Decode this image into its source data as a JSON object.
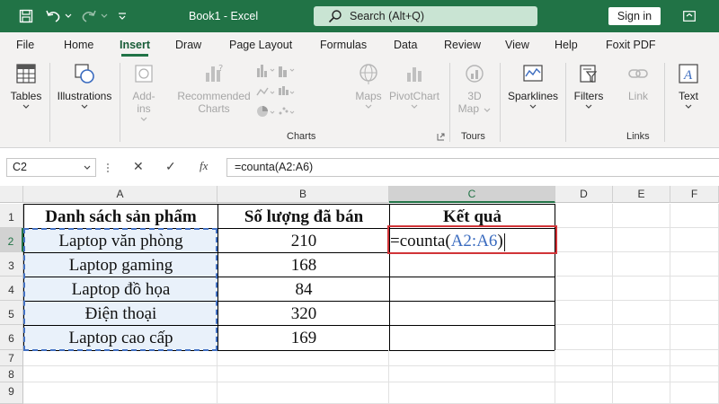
{
  "window": {
    "title": "Book1  -  Excel",
    "search_placeholder": "Search (Alt+Q)",
    "signin_label": "Sign in",
    "quick_access": [
      "save-icon",
      "undo-icon",
      "redo-icon",
      "customize-icon"
    ]
  },
  "menu": {
    "tabs": [
      "File",
      "Home",
      "Insert",
      "Draw",
      "Page Layout",
      "Formulas",
      "Data",
      "Review",
      "View",
      "Help",
      "Foxit PDF"
    ],
    "active": "Insert"
  },
  "ribbon": {
    "tables": "Tables",
    "illustrations": "Illustrations",
    "addins_1": "Add-",
    "addins_2": "ins",
    "recommended_1": "Recommended",
    "recommended_2": "Charts",
    "maps": "Maps",
    "pivotchart": "PivotChart",
    "map3d_1": "3D",
    "map3d_2": "Map",
    "sparklines": "Sparklines",
    "filters": "Filters",
    "link": "Link",
    "text": "Text",
    "group_charts": "Charts",
    "group_tours": "Tours",
    "group_links": "Links"
  },
  "formula_bar": {
    "name_box": "C2",
    "cancel": "✕",
    "enter": "✓",
    "fx": "fx",
    "formula": "=counta(A2:A6)"
  },
  "sheet": {
    "columns": [
      "A",
      "B",
      "C",
      "D",
      "E",
      "F"
    ],
    "rows": [
      "1",
      "2",
      "3",
      "4",
      "5",
      "6",
      "7",
      "8",
      "9"
    ],
    "header": {
      "a": "Danh sách sản phẩm",
      "b": "Số lượng đã bán",
      "c": "Kết quả"
    },
    "data": [
      {
        "product": "Laptop văn phòng",
        "qty": "210"
      },
      {
        "product": "Laptop gaming",
        "qty": "168"
      },
      {
        "product": "Laptop đồ họa",
        "qty": "84"
      },
      {
        "product": "Điện thoại",
        "qty": "320"
      },
      {
        "product": "Laptop cao cấp",
        "qty": "169"
      }
    ],
    "edit": {
      "prefix": "=counta(",
      "ref": "A2:A6",
      "suffix": ")"
    }
  },
  "colors": {
    "brand": "#217346",
    "search_bg": "#c9e4d3",
    "range_ref": "#3a6bbf",
    "active_outline": "#d13438"
  }
}
